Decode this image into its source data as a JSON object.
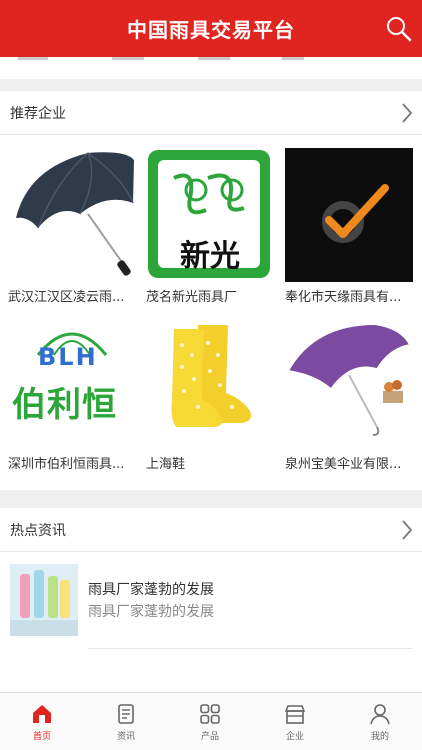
{
  "header": {
    "title": "中国雨具交易平台"
  },
  "recommended": {
    "title": "推荐企业",
    "companies": [
      {
        "name": "武汉江汉区凌云雨..."
      },
      {
        "name": "茂名新光雨具厂"
      },
      {
        "name": "奉化市天缘雨具有..."
      },
      {
        "name": "深圳市伯利恒雨具..."
      },
      {
        "name": "上海鞋"
      },
      {
        "name": "泉州宝美伞业有限..."
      }
    ],
    "logo_text": {
      "xinguang": "新光",
      "blh": "BLH",
      "bolihong": "伯利恒"
    }
  },
  "news": {
    "title": "热点资讯",
    "items": [
      {
        "title": "雨具厂家蓬勃的发展",
        "summary": "雨具厂家蓬勃的发展"
      }
    ]
  },
  "tabbar": {
    "items": [
      {
        "label": "首页"
      },
      {
        "label": "资讯"
      },
      {
        "label": "产品"
      },
      {
        "label": "企业"
      },
      {
        "label": "我的"
      }
    ]
  },
  "colors": {
    "brand": "#e0241f",
    "green": "#2ca63a"
  }
}
